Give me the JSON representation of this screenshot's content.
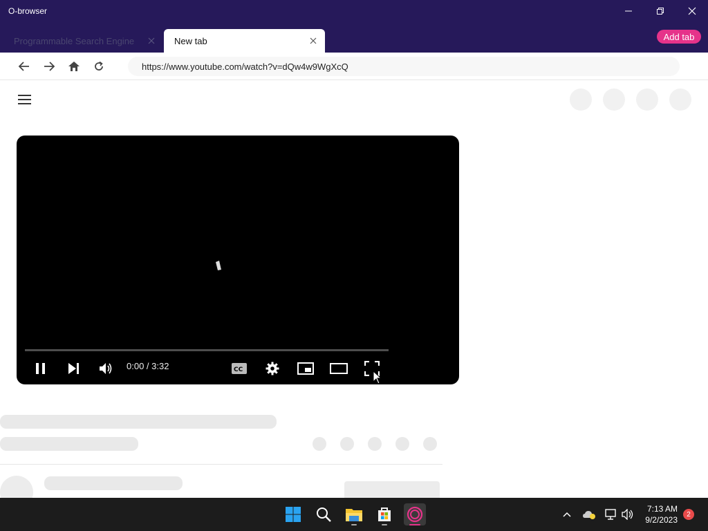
{
  "app": {
    "title": "O-browser"
  },
  "tabs": [
    {
      "label": "Programmable Search Engine",
      "active": false
    },
    {
      "label": "New tab",
      "active": true
    }
  ],
  "add_tab_label": "Add tab",
  "navbar": {
    "url": "https://www.youtube.com/watch?v=dQw4w9WgXcQ"
  },
  "player": {
    "time": "0:00 / 3:32"
  },
  "taskbar": {
    "time": "7:13 AM",
    "date": "9/2/2023",
    "notification_count": "2"
  },
  "colors": {
    "titlebar": "#26195a",
    "accent": "#e6338a",
    "player_bg": "#000000",
    "taskbar": "#1c1c1c"
  }
}
